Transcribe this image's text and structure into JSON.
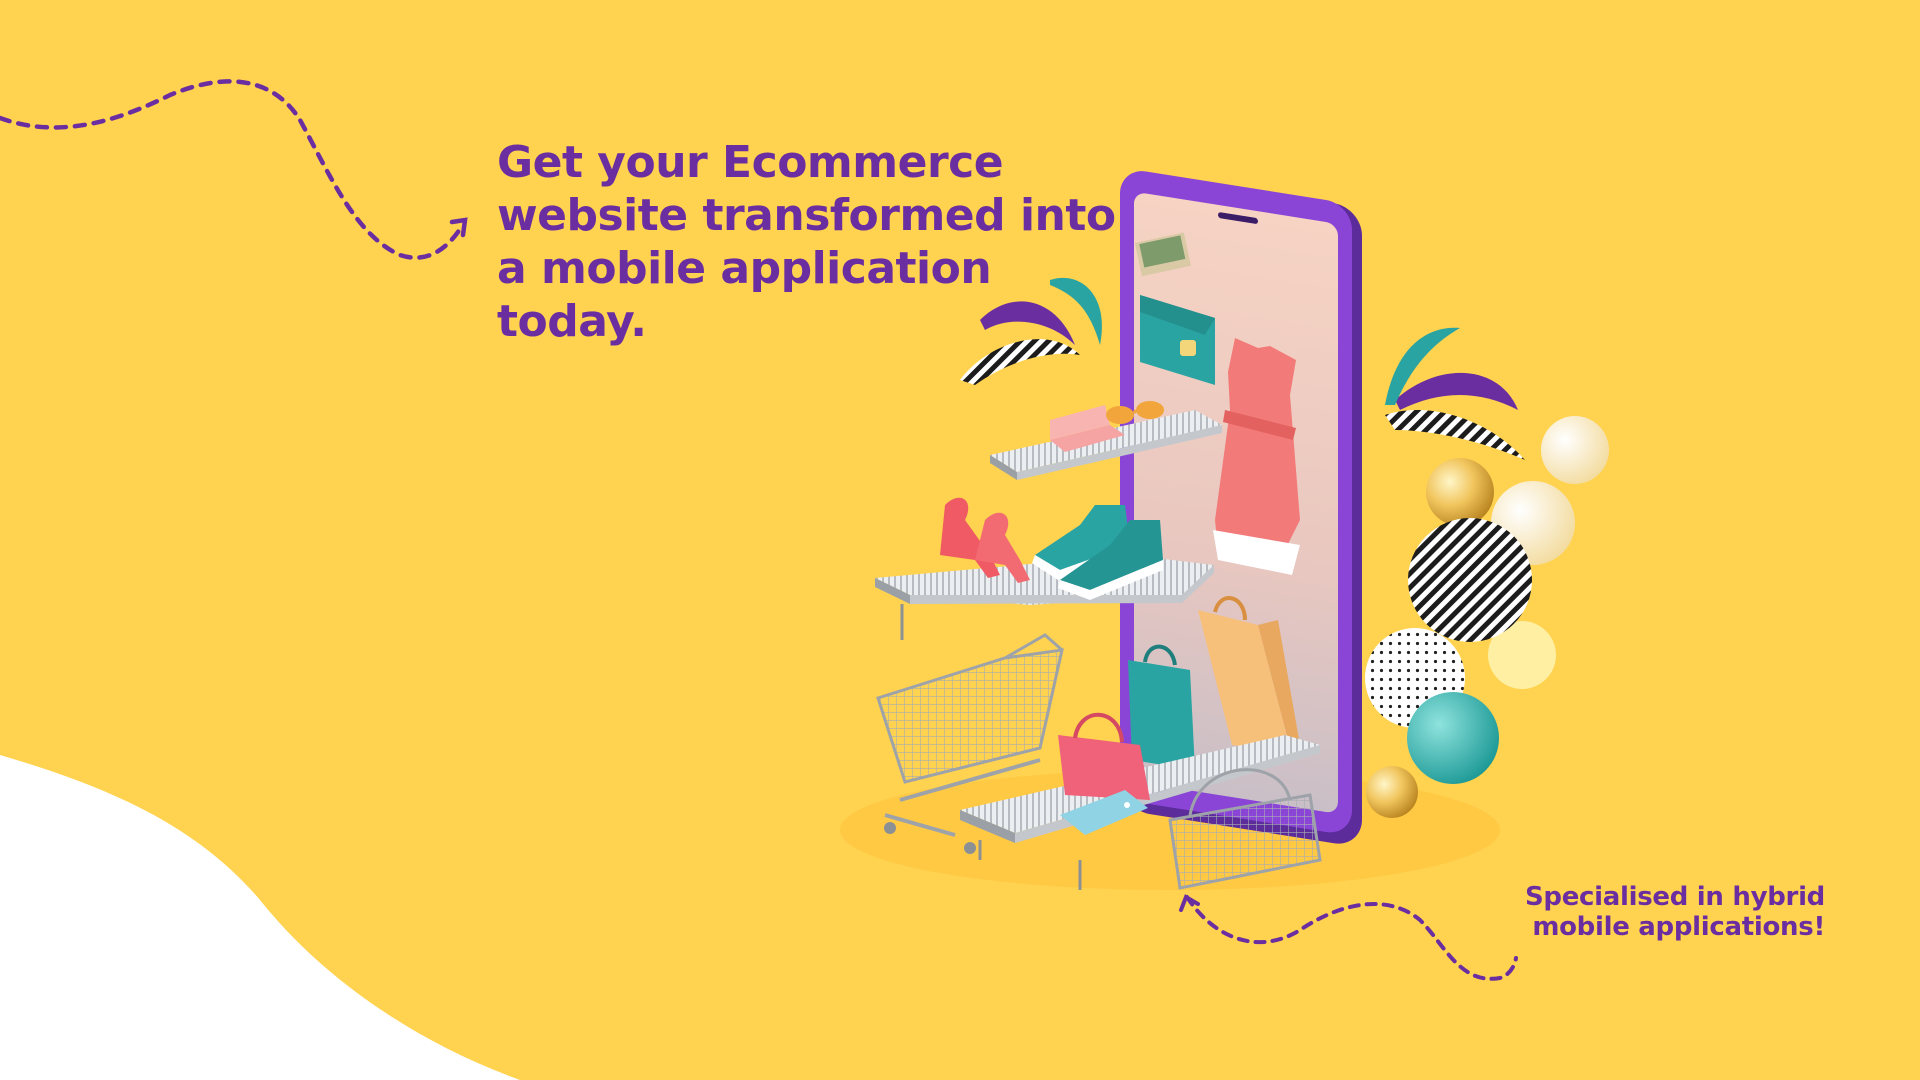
{
  "hero": {
    "headline": "Get your Ecommerce\nwebsite transformed into\na mobile application\ntoday.",
    "tagline": "Specialised in hybrid\nmobile applications!"
  },
  "colors": {
    "background": "#ffd24f",
    "text": "#6a2ea0",
    "phone": "#8a45d6",
    "accent_teal": "#2aa4a2",
    "accent_pink": "#f27a78"
  },
  "illustration": {
    "subject": "smartphone-shop-with-shelves",
    "icons": [
      "dashed-arrow-icon",
      "shopping-cart-icon",
      "shopping-basket-icon",
      "shopping-bag-icon",
      "dress-icon",
      "sneakers-icon",
      "high-heels-icon",
      "wallet-icon",
      "price-tag-icon",
      "decorative-ball-icon"
    ]
  }
}
